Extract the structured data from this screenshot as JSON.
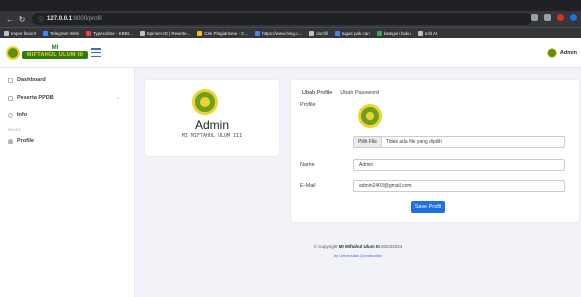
{
  "browser": {
    "url_host": "127.0.0.1",
    "url_path": ":8000/profil",
    "bookmarks": [
      "Impor favorit",
      "Telegram Web",
      "Typecolme - KBBI...",
      "Spinner.ID | Rewrite...",
      "Cek Plagiarisme - C...",
      "https://www.bing.c...",
      "docfill",
      "tugas pak can",
      "kategori buku",
      "edit AI"
    ]
  },
  "header": {
    "logo_top": "MI",
    "logo_name": "MIFTAHUL ULUM III",
    "user_name": "Admin"
  },
  "sidebar": {
    "items": [
      {
        "label": "Dashboard",
        "icon": "dashboard-icon"
      },
      {
        "label": "Peserta PPDB",
        "icon": "list-icon"
      },
      {
        "label": "Info",
        "icon": "info-icon"
      },
      {
        "label": "Profile",
        "icon": "user-icon"
      }
    ],
    "section_label": "PAGES"
  },
  "profile_card": {
    "name": "Admin",
    "school": "MI MIFTAHUL ULUM III"
  },
  "edit_card": {
    "tabs": [
      "Ubah Profile",
      "Ubah Password"
    ],
    "profile_label": "Profile",
    "file_button": "Pilih File",
    "file_status": "Tidak ada file yang dipilih",
    "name_label": "Name",
    "name_value": "Admin",
    "email_label": "E-Mail",
    "email_value": "admin2403@gmail.com",
    "save_button": "Save Profil"
  },
  "footer": {
    "prefix": "© Copyright",
    "brand": "MI Miftahul Ulum III",
    "year": "2023/2024",
    "credit": "by Universitas Qomaruddin"
  },
  "colors": {
    "accent": "#1f6fe5",
    "brand_green": "#2f7d12",
    "brand_yellow": "#f2d22e"
  }
}
